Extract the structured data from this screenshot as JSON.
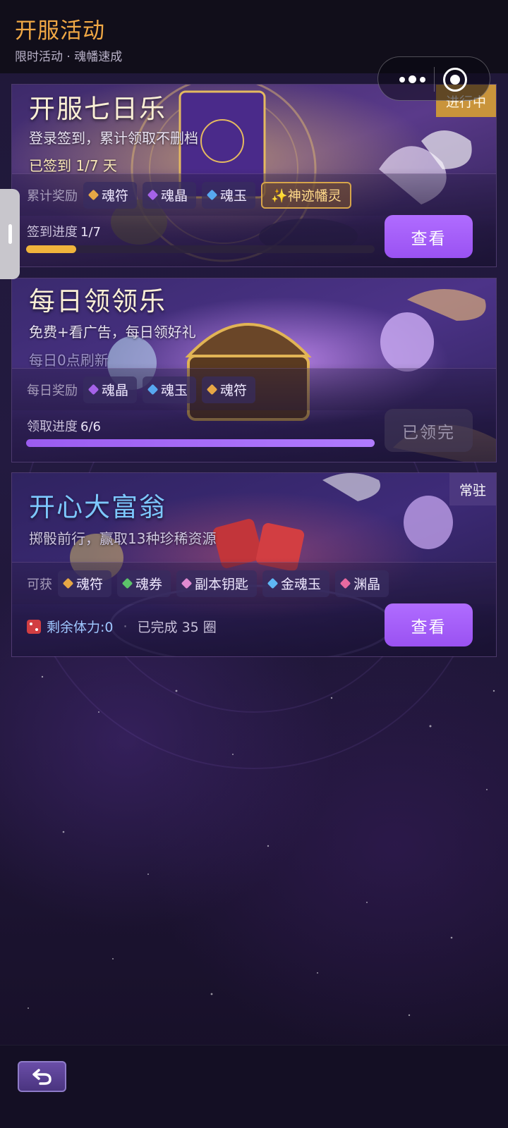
{
  "header": {
    "title": "开服活动",
    "subtitle": "限时活动 · 魂幡速成"
  },
  "capsule": {
    "more_icon": "more-dots-icon",
    "close_icon": "target-close-icon"
  },
  "cards": [
    {
      "title": "开服七日乐",
      "desc": "登录签到，累计领取不删档",
      "note": "已签到 1/7 天",
      "badge": "进行中",
      "rewards_label": "累计奖励",
      "rewards": [
        "魂符",
        "魂晶",
        "魂玉",
        "✨神迹幡灵"
      ],
      "progress_label": "签到进度",
      "progress_value": "1/7",
      "progress_fraction": 0.143,
      "button": "查看",
      "accent": "#f0b43c"
    },
    {
      "title": "每日领领乐",
      "desc": "免费+看广告，每日领好礼",
      "note": "每日0点刷新",
      "rewards_label": "每日奖励",
      "rewards": [
        "魂晶",
        "魂玉",
        "魂符"
      ],
      "progress_label": "领取进度",
      "progress_value": "6/6",
      "progress_fraction": 1.0,
      "button": "已领完",
      "accent": "#a86cf5"
    },
    {
      "title": "开心大富翁",
      "desc": "掷骰前行，赢取13种珍稀资源",
      "badge": "常驻",
      "rewards_label": "可获",
      "rewards": [
        "魂符",
        "魂券",
        "副本钥匙",
        "金魂玉",
        "渊晶"
      ],
      "stamina": "剩余体力:0",
      "separator": "·",
      "completed": "已完成 35 圈",
      "button": "查看"
    }
  ],
  "footer": {
    "back_icon": "return-arrow-icon"
  }
}
